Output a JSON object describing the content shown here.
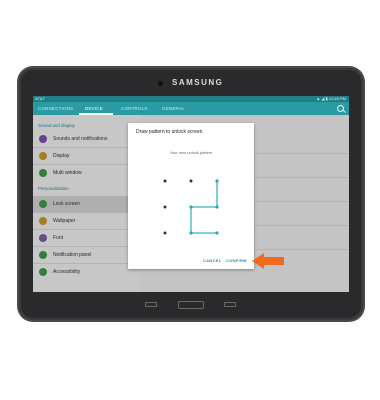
{
  "device": {
    "brand": "SAMSUNG"
  },
  "statusbar": {
    "carrier": "AT&T",
    "right": "▲ ◢ ▮ 12:45 PM"
  },
  "tabs": [
    {
      "label": "CONNECTIONS",
      "active": false
    },
    {
      "label": "DEVICE",
      "active": true
    },
    {
      "label": "CONTROLS",
      "active": false
    },
    {
      "label": "GENERAL",
      "active": false
    }
  ],
  "settings": {
    "section_sound": "Sound and display",
    "section_personalization": "Personalization",
    "items": [
      {
        "label": "Sounds and notifications",
        "icon": "bell-icon",
        "color": "#7a4fb3"
      },
      {
        "label": "Display",
        "icon": "display-icon",
        "color": "#c79a2b"
      },
      {
        "label": "Multi window",
        "icon": "multi-window-icon",
        "color": "#3f9a48"
      },
      {
        "label": "Lock screen",
        "icon": "lock-icon",
        "color": "#3f9a48",
        "selected": true
      },
      {
        "label": "Wallpaper",
        "icon": "wallpaper-icon",
        "color": "#c79a2b"
      },
      {
        "label": "Font",
        "icon": "font-icon",
        "color": "#7a5fa8"
      },
      {
        "label": "Notification panel",
        "icon": "notification-panel-icon",
        "color": "#3f9a48"
      },
      {
        "label": "Accessibility",
        "icon": "accessibility-icon",
        "color": "#3f9a48"
      }
    ]
  },
  "dialog": {
    "title": "Draw pattern to unlock screen",
    "subtitle": "Your new unlock pattern",
    "cancel": "CANCEL",
    "confirm": "CONFIRM",
    "pattern_sequence": [
      3,
      6,
      5,
      8,
      9
    ]
  },
  "colors": {
    "accent": "#2a9aa3",
    "highlight_arrow": "#f06a1e"
  }
}
